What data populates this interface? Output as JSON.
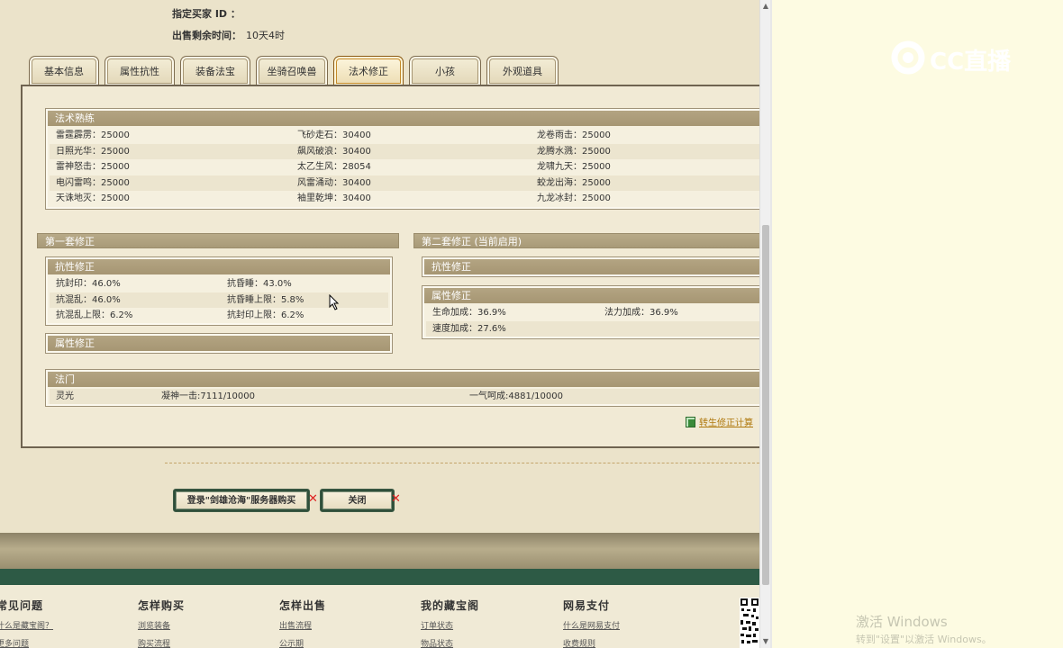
{
  "header": {
    "buyer_id_label": "指定买家 ID ：",
    "time_left_label": "出售剩余时间：",
    "time_left_value": "10天4时"
  },
  "tabs": [
    {
      "label": "基本信息",
      "active": false
    },
    {
      "label": "属性抗性",
      "active": false
    },
    {
      "label": "装备法宝",
      "active": false
    },
    {
      "label": "坐骑召唤兽",
      "active": false
    },
    {
      "label": "法术修正",
      "active": true
    },
    {
      "label": "小孩",
      "active": false
    },
    {
      "label": "外观道具",
      "active": false
    }
  ],
  "spell_mastery": {
    "title": "法术熟练",
    "rows": [
      [
        "雷霆霹雳：25000",
        "飞砂走石：30400",
        "龙卷雨击：25000"
      ],
      [
        "日照光华：25000",
        "飙风破浪：30400",
        "龙腾水溅：25000"
      ],
      [
        "雷神怒击：25000",
        "太乙生风：28054",
        "龙啸九天：25000"
      ],
      [
        "电闪雷鸣：25000",
        "风雷涌动：30400",
        "蛟龙出海：25000"
      ],
      [
        "天诛地灭：25000",
        "袖里乾坤：30400",
        "九龙冰封：25000"
      ]
    ]
  },
  "set1": {
    "title": "第一套修正",
    "resist": {
      "title": "抗性修正",
      "rows": [
        [
          "抗封印：46.0%",
          "抗昏睡：43.0%"
        ],
        [
          "抗混乱：46.0%",
          "抗昏睡上限：5.8%"
        ],
        [
          "抗混乱上限：6.2%",
          "抗封印上限：6.2%"
        ]
      ]
    },
    "attr_title": "属性修正"
  },
  "set2": {
    "title": "第二套修正 (当前启用)",
    "resist_title": "抗性修正",
    "attr": {
      "title": "属性修正",
      "rows": [
        [
          "生命加成：36.9%",
          "法力加成：36.9%"
        ],
        [
          "速度加成：27.6%",
          ""
        ]
      ]
    }
  },
  "faction": {
    "title": "法门",
    "row": [
      "灵光",
      "凝神一击:7111/10000",
      "一气呵成:4881/10000"
    ]
  },
  "calc_link": "转生修正计算",
  "buttons": {
    "login_buy": "登录\"剑雄沧海\"服务器购买",
    "close": "关闭"
  },
  "footer": {
    "columns": [
      {
        "title": "常见问题",
        "links": [
          "什么是藏宝阁？",
          "更多问题"
        ]
      },
      {
        "title": "怎样购买",
        "links": [
          "浏览装备",
          "购买流程"
        ]
      },
      {
        "title": "怎样出售",
        "links": [
          "出售流程",
          "公示期"
        ]
      },
      {
        "title": "我的藏宝阁",
        "links": [
          "订单状态",
          "物品状态"
        ]
      },
      {
        "title": "网易支付",
        "links": [
          "什么是网易支付",
          "收费规则"
        ]
      }
    ]
  },
  "watermark": {
    "logo_text": "CC直播",
    "activation_title": "激活 Windows",
    "activation_sub": "转到\"设置\"以激活 Windows。"
  },
  "colors": {
    "page_bg": "#ebe3ca",
    "box_title": "#a69673",
    "footer_band": "#2d5a45",
    "active_tab_border": "#c48a2a",
    "close_x": "#dd2222"
  }
}
